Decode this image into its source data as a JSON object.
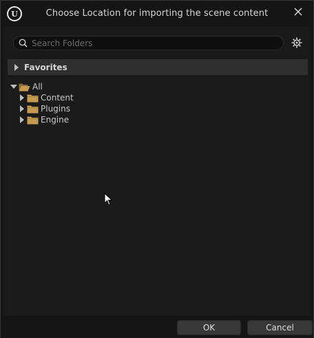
{
  "window": {
    "title": "Choose Location for importing the scene content",
    "logo_text": "U"
  },
  "search": {
    "placeholder": "Search Folders",
    "value": ""
  },
  "favorites": {
    "label": "Favorites"
  },
  "tree": {
    "root": "All",
    "children": [
      "Content",
      "Plugins",
      "Engine"
    ]
  },
  "footer": {
    "ok_label": "OK",
    "cancel_label": "Cancel"
  },
  "colors": {
    "folder": "#c49a55",
    "background": "#151515",
    "panel": "#1a1a1a",
    "header": "#2f2f2f"
  }
}
